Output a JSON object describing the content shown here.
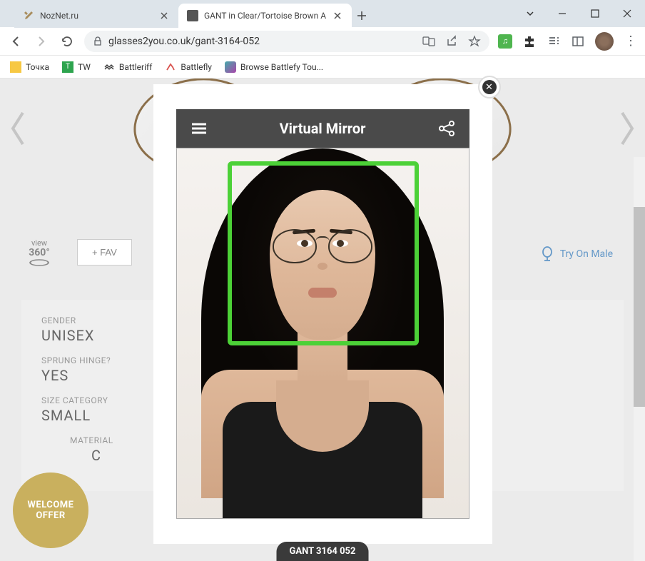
{
  "tabs": [
    {
      "title": "NozNet.ru",
      "active": false
    },
    {
      "title": "GANT in Clear/Tortoise Brown A",
      "active": true
    }
  ],
  "url": "glasses2you.co.uk/gant-3164-052",
  "bookmarks": [
    {
      "label": "Точка"
    },
    {
      "label": "TW"
    },
    {
      "label": "Battleriff"
    },
    {
      "label": "Battlefly"
    },
    {
      "label": "Browse Battlefy Tou..."
    }
  ],
  "product": {
    "view360": "view",
    "view360deg": "360°",
    "favLabel": "+ FAV",
    "tryOnMale": "Try On Male",
    "specs": [
      {
        "label": "GENDER",
        "value": "UNISEX"
      },
      {
        "label": "SPRUNG HINGE?",
        "value": "YES"
      },
      {
        "label": "SIZE CATEGORY",
        "value": "SMALL"
      },
      {
        "label": "MATERIAL",
        "value": "C"
      }
    ],
    "pill": "GANT 3164 052"
  },
  "welcomeOffer": {
    "line1": "WELCOME",
    "line2": "OFFER"
  },
  "modal": {
    "title": "Virtual Mirror"
  }
}
